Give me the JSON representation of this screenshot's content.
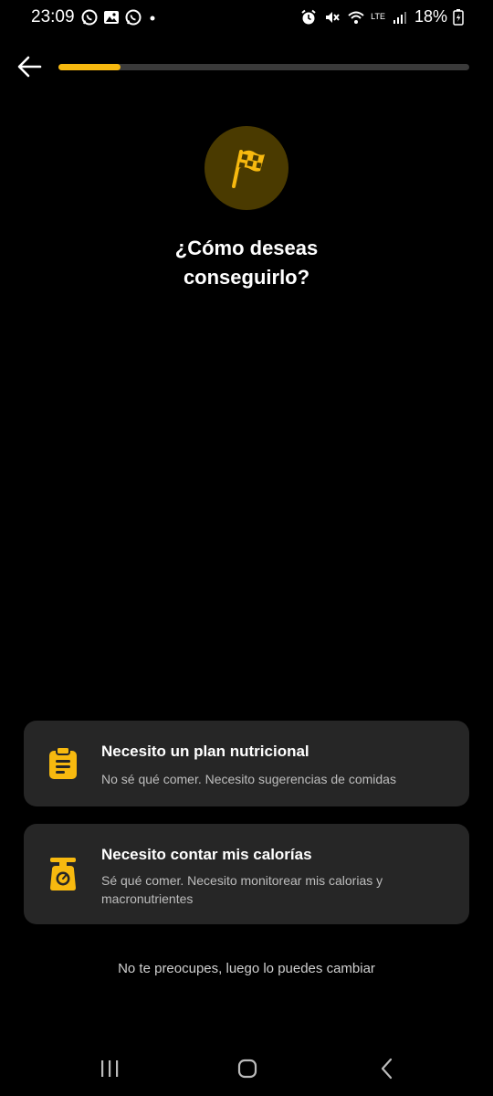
{
  "status_bar": {
    "time": "23:09",
    "battery": "18%",
    "network": "LTE"
  },
  "progress": {
    "fraction": 0.15,
    "color": "#f7b90f"
  },
  "header": {
    "back_icon": "arrow-left-icon"
  },
  "hero": {
    "icon": "checkered-flag-icon",
    "title": "¿Cómo deseas conseguirlo?"
  },
  "options": [
    {
      "icon": "clipboard-list-icon",
      "title": "Necesito un plan nutricional",
      "description": "No sé qué comer. Necesito sugerencias de comidas"
    },
    {
      "icon": "kitchen-scale-icon",
      "title": "Necesito contar mis calorías",
      "description": "Sé qué comer. Necesito monitorear mis calorias y macronutrientes"
    }
  ],
  "footer": {
    "note": "No te preocupes, luego lo puedes cambiar"
  },
  "colors": {
    "accent": "#f7b90f",
    "card_bg": "#262626",
    "badge_bg": "#4a3a00"
  }
}
